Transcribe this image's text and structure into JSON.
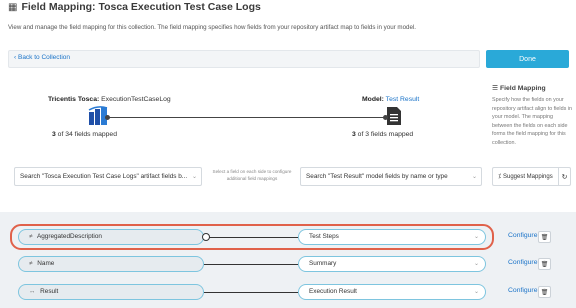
{
  "header": {
    "title": "Field Mapping: Tosca Execution Test Case Logs",
    "description": "View and manage the field mapping for this collection. The field mapping specifies how fields from your repository artifact map to fields in your model."
  },
  "nav": {
    "back_label": "Back to Collection",
    "done_label": "Done"
  },
  "source": {
    "system": "Tricentis Tosca:",
    "artifact": "ExecutionTestCaseLog",
    "count_mapped": "3",
    "count_text": "of 34 fields mapped"
  },
  "target": {
    "label": "Model:",
    "model": "Test Result",
    "count_mapped": "3",
    "count_text": "of 3 fields mapped"
  },
  "help": {
    "heading": "Field Mapping",
    "text": "Specify how the fields on your repository artifact align to fields in your model. The mapping between the fields on each side forms the field mapping for this collection."
  },
  "search": {
    "source_placeholder": "Search \"Tosca Execution Test Case Logs\" artifact fields b...",
    "hint": "Select a field on each side to configure additional field mappings",
    "target_placeholder": "Search \"Test Result\" model fields by name or type",
    "suggest_label": "Suggest Mappings"
  },
  "mappings": [
    {
      "type_glyph": "≠",
      "source": "AggregatedDescription",
      "target": "Test Steps",
      "configure": "Configure"
    },
    {
      "type_glyph": "≠",
      "source": "Name",
      "target": "Summary",
      "configure": "Configure"
    },
    {
      "type_glyph": "↔",
      "source": "Result",
      "target": "Execution Result",
      "configure": "Configure"
    }
  ],
  "colors": {
    "accent": "#2aa9d8",
    "link": "#1a73c8",
    "highlight": "#e0614a"
  }
}
